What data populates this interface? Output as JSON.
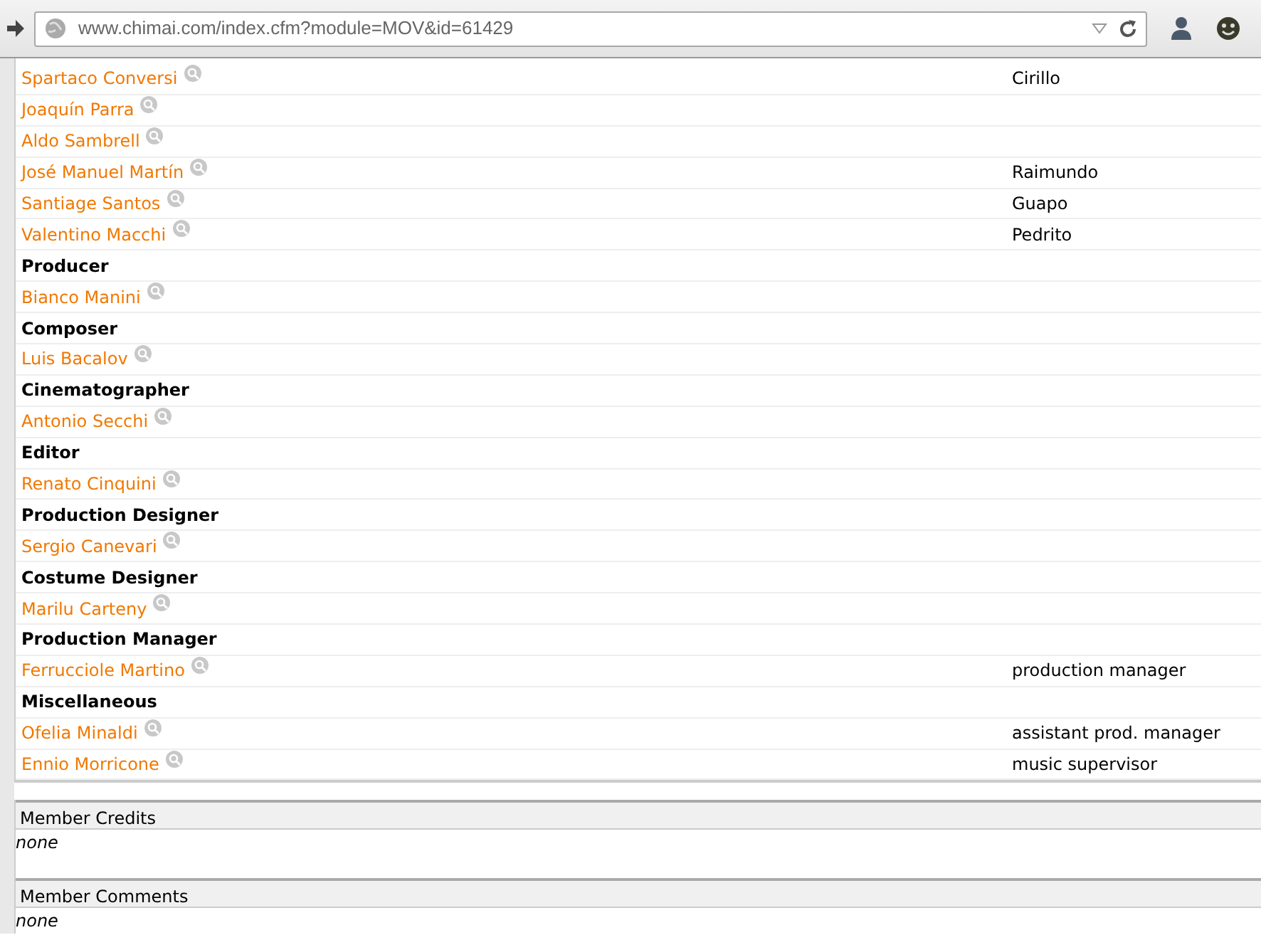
{
  "address_bar": {
    "url": "www.chimai.com/index.cfm?module=MOV&id=61429"
  },
  "credits": [
    {
      "kind": "person",
      "name": "Spartaco Conversi",
      "role": "Cirillo"
    },
    {
      "kind": "person",
      "name": "Joaquín Parra"
    },
    {
      "kind": "person",
      "name": "Aldo Sambrell"
    },
    {
      "kind": "person",
      "name": "José Manuel Martín",
      "role": "Raimundo"
    },
    {
      "kind": "person",
      "name": "Santiage Santos",
      "role": "Guapo"
    },
    {
      "kind": "person",
      "name": "Valentino Macchi",
      "role": "Pedrito"
    },
    {
      "kind": "heading",
      "label": "Producer"
    },
    {
      "kind": "person",
      "name": "Bianco Manini"
    },
    {
      "kind": "heading",
      "label": "Composer"
    },
    {
      "kind": "person",
      "name": "Luis Bacalov"
    },
    {
      "kind": "heading",
      "label": "Cinematographer"
    },
    {
      "kind": "person",
      "name": "Antonio Secchi"
    },
    {
      "kind": "heading",
      "label": "Editor"
    },
    {
      "kind": "person",
      "name": "Renato Cinquini"
    },
    {
      "kind": "heading",
      "label": "Production Designer"
    },
    {
      "kind": "person",
      "name": "Sergio Canevari"
    },
    {
      "kind": "heading",
      "label": "Costume Designer"
    },
    {
      "kind": "person",
      "name": "Marilu Carteny"
    },
    {
      "kind": "heading",
      "label": "Production Manager"
    },
    {
      "kind": "person",
      "name": "Ferrucciole Martino",
      "role": "production manager"
    },
    {
      "kind": "heading",
      "label": "Miscellaneous"
    },
    {
      "kind": "person",
      "name": "Ofelia Minaldi",
      "role": "assistant prod. manager"
    },
    {
      "kind": "person",
      "name": "Ennio Morricone",
      "role": "music supervisor"
    }
  ],
  "sections": [
    {
      "title": "Member Credits",
      "body": "none"
    },
    {
      "title": "Member Comments",
      "body": "none"
    }
  ]
}
